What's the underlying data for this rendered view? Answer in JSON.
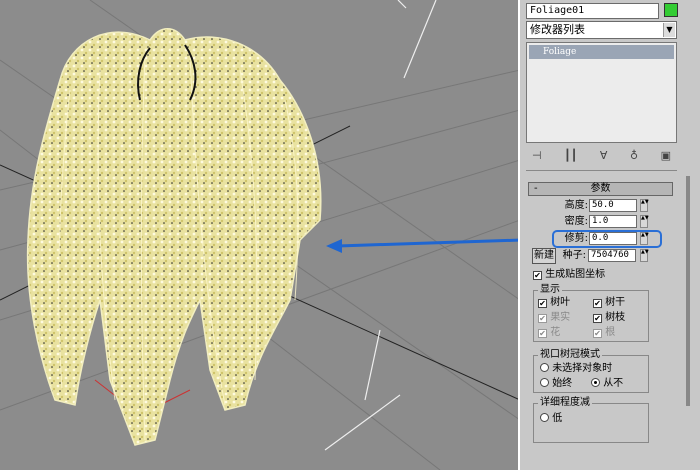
{
  "object_name": "Foliage01",
  "object_color": "#33cc33",
  "modifier_list_label": "修改器列表",
  "stack": {
    "items": [
      "Foliage"
    ]
  },
  "stack_tools": [
    "pin-stack-icon",
    "show-end-result-icon",
    "make-unique-icon",
    "remove-modifier-icon",
    "configure-sets-icon"
  ],
  "params": {
    "rollout_title": "参数",
    "rollout_toggle": "-",
    "height_label": "高度:",
    "height_value": "50.0",
    "density_label": "密度:",
    "density_value": "1.0",
    "prune_label": "修剪:",
    "prune_value": "0.0",
    "new_button": "新建",
    "seed_label": "种子:",
    "seed_value": "7504760",
    "gen_mapping_label": "生成贴图坐标",
    "gen_mapping_checked": true
  },
  "display": {
    "title": "显示",
    "items": [
      {
        "label": "树叶",
        "checked": true,
        "disabled": false
      },
      {
        "label": "树干",
        "checked": true,
        "disabled": false
      },
      {
        "label": "果实",
        "checked": true,
        "disabled": true
      },
      {
        "label": "树枝",
        "checked": true,
        "disabled": false
      },
      {
        "label": "花",
        "checked": true,
        "disabled": true
      },
      {
        "label": "根",
        "checked": true,
        "disabled": true
      }
    ]
  },
  "viewport_canopy": {
    "title": "视口树冠模式",
    "options": [
      {
        "label": "未选择对象时",
        "selected": false
      },
      {
        "label": "始终",
        "selected": false
      },
      {
        "label": "从不",
        "selected": true
      }
    ]
  },
  "level_of_detail": {
    "title": "详细程度减",
    "option_low": "低"
  },
  "colors": {
    "highlight": "#2a6fd6",
    "arrow": "#1f66d1"
  }
}
